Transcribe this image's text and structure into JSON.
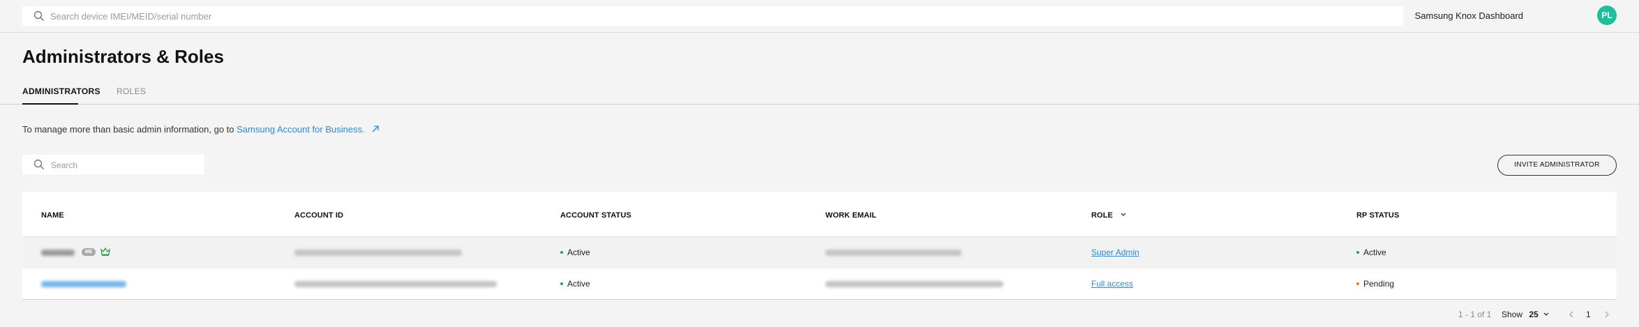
{
  "header": {
    "search_placeholder": "Search device IMEI/MEID/serial number",
    "dashboard_label": "Samsung Knox Dashboard",
    "avatar_initials": "PL"
  },
  "page": {
    "title": "Administrators & Roles"
  },
  "tabs": [
    {
      "label": "ADMINISTRATORS",
      "active": true
    },
    {
      "label": "ROLES",
      "active": false
    }
  ],
  "info": {
    "text": "To manage more than basic admin information, go to",
    "link": "Samsung Account for Business."
  },
  "list_search": {
    "placeholder": "Search"
  },
  "invite_button": "INVITE ADMINISTRATOR",
  "table": {
    "columns": [
      "NAME",
      "ACCOUNT ID",
      "ACCOUNT STATUS",
      "WORK EMAIL",
      "ROLE",
      "RP STATUS"
    ],
    "rows": [
      {
        "me_badge": "ME",
        "account_status": "Active",
        "role": "Super Admin",
        "rp_status": "Active"
      },
      {
        "account_status": "Active",
        "role": "Full access",
        "rp_status": "Pending"
      }
    ]
  },
  "pagination": {
    "range": "1 - 1 of 1",
    "show_label": "Show",
    "page_size": "25",
    "current_page": "1"
  },
  "colors": {
    "active_status": "#2ca24c",
    "pending_status": "#e87722",
    "link": "#2b8bd6",
    "avatar": "#1fbf9c"
  }
}
